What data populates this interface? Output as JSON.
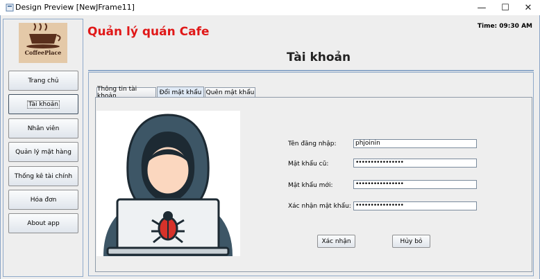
{
  "window": {
    "title": "Design Preview [NewJFrame11]",
    "minimize_glyph": "—",
    "maximize_glyph": "☐",
    "close_glyph": "✕"
  },
  "app": {
    "title": "Quản lý quán Cafe",
    "time": "Time: 09:30 AM",
    "logo_text": "CoffeePlace"
  },
  "sidebar": {
    "items": [
      {
        "label": "Trang chủ"
      },
      {
        "label": "Tài khoản",
        "active": true
      },
      {
        "label": "Nhân viên"
      },
      {
        "label": "Quản lý mặt hàng"
      },
      {
        "label": "Thống kê tài chính"
      },
      {
        "label": "Hóa đơn"
      },
      {
        "label": "About app"
      }
    ]
  },
  "page": {
    "heading": "Tài khoản"
  },
  "tabs": [
    {
      "label": "Thông tin tài khoản"
    },
    {
      "label": "Đổi mật khẩu",
      "selected": true
    },
    {
      "label": "Quên mật khẩu"
    }
  ],
  "form": {
    "username_label": "Tên đăng nhập:",
    "username_value": "phjoinin",
    "old_password_label": "Mật khẩu cũ:",
    "old_password_value": "••••••••••••••••",
    "new_password_label": "Mật khẩu mới:",
    "new_password_value": "••••••••••••••••",
    "confirm_password_label": "Xác nhận mật khẩu:",
    "confirm_password_value": "••••••••••••••••",
    "confirm_button": "Xác nhận",
    "cancel_button": "Hủy bỏ"
  },
  "colors": {
    "app_title": "#e01818",
    "panel_border": "#8fa9c9",
    "hood": "#3d5666"
  }
}
